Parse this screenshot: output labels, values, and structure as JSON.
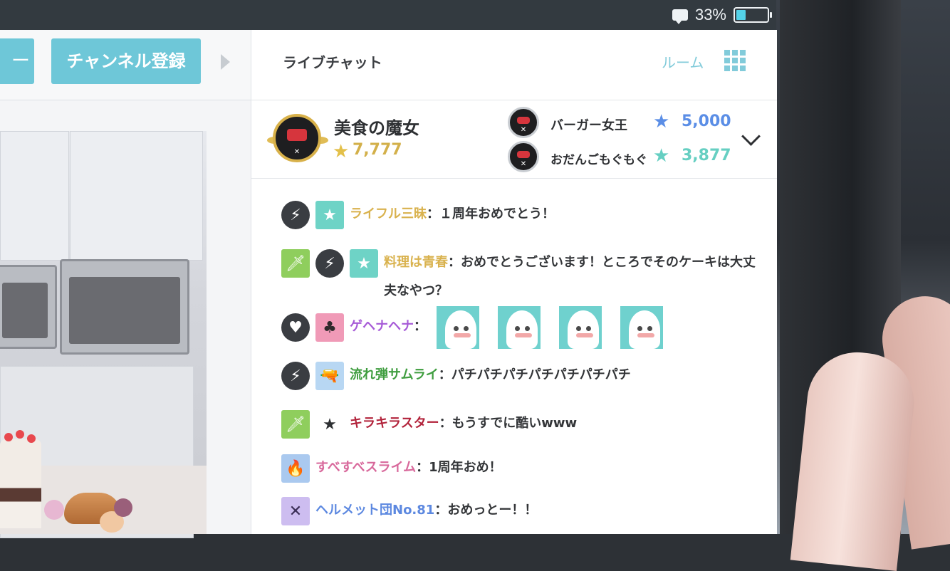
{
  "status_bar": {
    "battery_text": "33%",
    "battery_level": 0.33
  },
  "left": {
    "partial_button_label": "ー",
    "channel_button_label": "チャンネル登録"
  },
  "chat": {
    "title": "ライブチャット",
    "room_label": "ルーム",
    "ranking": {
      "top": {
        "name": "美食の魔女",
        "score": "7,777"
      },
      "second": {
        "name": "バーガー女王",
        "score": "5,000"
      },
      "third": {
        "name": "おだんごもぐもぐ",
        "score": "3,877"
      }
    },
    "messages": [
      {
        "user": "ライフル三昧",
        "text": "：１周年おめでとう！",
        "color": "#d9b24e"
      },
      {
        "user": "料理は青春",
        "text": "：おめでとうございます！ところでそのケーキは大丈",
        "text2": "夫なやつ？",
        "color": "#d9b24e"
      },
      {
        "user": "ゲヘナヘナ",
        "text": "：",
        "color": "#a65ad7"
      },
      {
        "user": "流れ弾サムライ",
        "text": "：パチパチパチパチパチパチパチ",
        "color": "#3f9d3f"
      },
      {
        "user": "キラキラスター",
        "text": "：もうすでに酷いwww",
        "color": "#b2233b"
      },
      {
        "user": "すべすべスライム",
        "text": "：1周年おめ！",
        "color": "#d8689b"
      },
      {
        "user": "ヘルメット団No.81",
        "text": "：おめっとー！！",
        "color": "#5c88e0"
      }
    ]
  },
  "icons": {
    "lightning": "⚡",
    "star": "★",
    "sword": "🗡",
    "heart": "♥",
    "club": "♣",
    "gun": "🔫",
    "flame": "🔥",
    "helmet": "✕"
  },
  "colors": {
    "accent": "#6ec7d8",
    "gold": "#d3b04a",
    "blue_score": "#5b8ee6",
    "teal_score": "#66cfc2"
  }
}
